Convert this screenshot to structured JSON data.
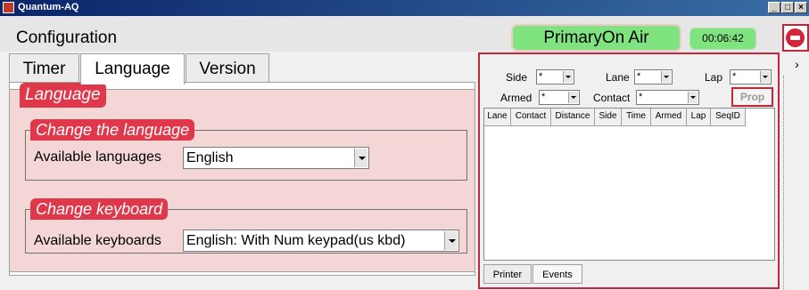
{
  "window": {
    "title": "Quantum-AQ",
    "buttons": {
      "minimize": "_",
      "maximize": "□",
      "close": "×"
    }
  },
  "header": {
    "config_title": "Configuration",
    "status": "PrimaryOn Air",
    "clock": "00:06:42",
    "exit_icon": "exit-icon"
  },
  "tabs": [
    {
      "label": "Timer",
      "active": false
    },
    {
      "label": "Language",
      "active": true
    },
    {
      "label": "Version",
      "active": false
    }
  ],
  "language_group": {
    "legend": "Language",
    "change_language": {
      "legend": "Change the language",
      "label": "Available languages",
      "value": "English"
    },
    "change_keyboard": {
      "legend": "Change keyboard",
      "label": "Available keyboards",
      "value": "English: With Num keypad(us kbd)"
    }
  },
  "events_panel": {
    "filters": {
      "side": {
        "label": "Side",
        "value": "*"
      },
      "lane": {
        "label": "Lane",
        "value": "*"
      },
      "lap": {
        "label": "Lap",
        "value": "*"
      },
      "armed": {
        "label": "Armed",
        "value": "*"
      },
      "contact": {
        "label": "Contact",
        "value": "*"
      }
    },
    "prop_button": "Prop",
    "columns": [
      "Lane",
      "Contact",
      "Distance",
      "Side",
      "Time",
      "Armed",
      "Lap",
      "SeqID"
    ],
    "bottom_tabs": [
      {
        "label": "Printer",
        "active": false
      },
      {
        "label": "Events",
        "active": true
      }
    ]
  },
  "side_toggle": "›"
}
